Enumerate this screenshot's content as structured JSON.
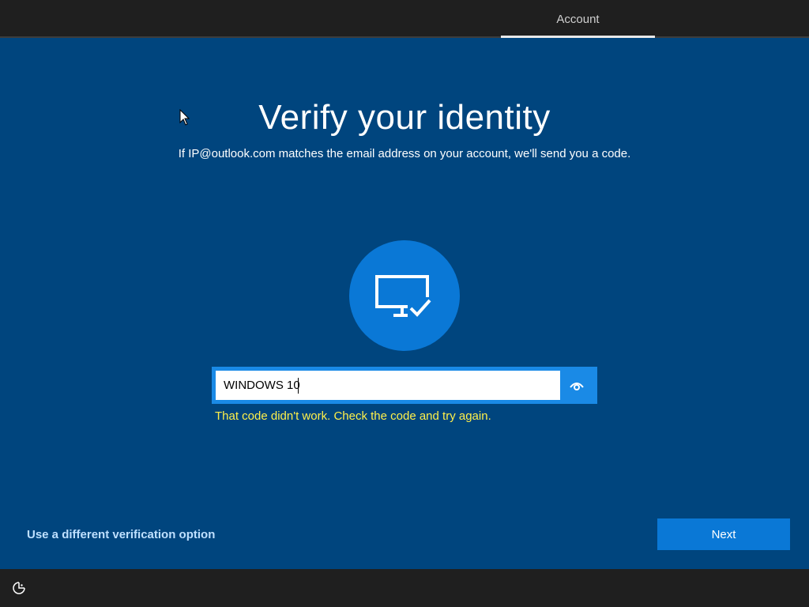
{
  "header": {
    "tab_label": "Account"
  },
  "main": {
    "title": "Verify your identity",
    "subtitle": "If IP@outlook.com matches the email address on your account, we'll send you a code.",
    "hero_icon": "pc-checkmark-icon",
    "code_input": {
      "value": "WINDOWS 10",
      "reveal_icon": "eye-icon"
    },
    "error_message": "That code didn't work. Check the code and try again."
  },
  "footer": {
    "alt_option_label": "Use a different verification option",
    "next_label": "Next",
    "accessibility_icon": "accessibility-icon"
  },
  "colors": {
    "background": "#00457e",
    "accent": "#0a78d6",
    "error": "#fff04a",
    "bar": "#1f1f1f"
  }
}
